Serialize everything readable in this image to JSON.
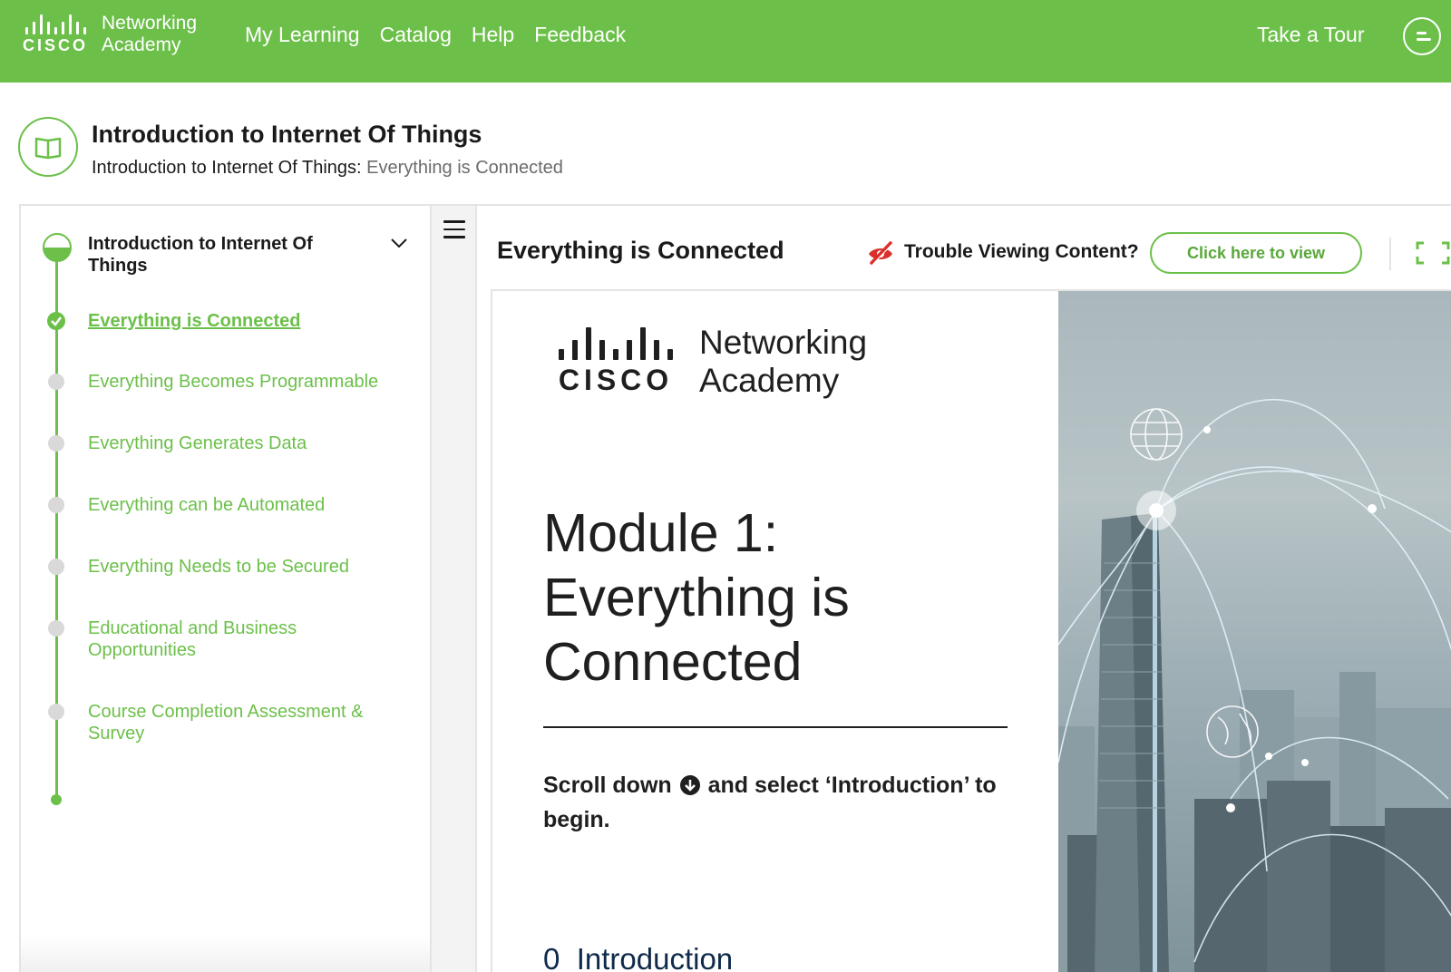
{
  "brand": {
    "logo_word": "CISCO",
    "logo_text_line1": "Networking",
    "logo_text_line2": "Academy",
    "color_green": "#6cc04a"
  },
  "nav": {
    "items": [
      {
        "label": "My Learning"
      },
      {
        "label": "Catalog"
      },
      {
        "label": "Help"
      },
      {
        "label": "Feedback"
      }
    ],
    "tour_label": "Take a Tour",
    "chat_icon": "chat-icon"
  },
  "course": {
    "title": "Introduction to Internet Of Things",
    "breadcrumb_parent": "Introduction to Internet Of Things:",
    "breadcrumb_current": "Everything is Connected",
    "icon": "book-icon"
  },
  "outline": {
    "module_title": "Introduction to Internet Of Things",
    "items": [
      {
        "label": "Everything is Connected",
        "status": "completed"
      },
      {
        "label": "Everything Becomes Programmable",
        "status": "not-started"
      },
      {
        "label": "Everything Generates Data",
        "status": "not-started"
      },
      {
        "label": "Everything can be Automated",
        "status": "not-started"
      },
      {
        "label": "Everything Needs to be Secured",
        "status": "not-started"
      },
      {
        "label": "Educational and Business Opportunities",
        "status": "not-started"
      },
      {
        "label": "Course Completion Assessment & Survey",
        "status": "not-started"
      }
    ]
  },
  "content": {
    "heading": "Everything is Connected",
    "trouble_label": "Trouble Viewing Content?",
    "view_button": "Click here to view",
    "fullscreen_icon": "fullscreen-icon"
  },
  "slide": {
    "logo_word": "CISCO",
    "logo_text_line1": "Networking",
    "logo_text_line2": "Academy",
    "title_line1": "Module 1:",
    "title_line2": "Everything is",
    "title_line3": "Connected",
    "instruction_before": "Scroll down",
    "instruction_after": "and select ‘Introduction’ to begin.",
    "intro_number": "0",
    "intro_label": "Introduction"
  }
}
